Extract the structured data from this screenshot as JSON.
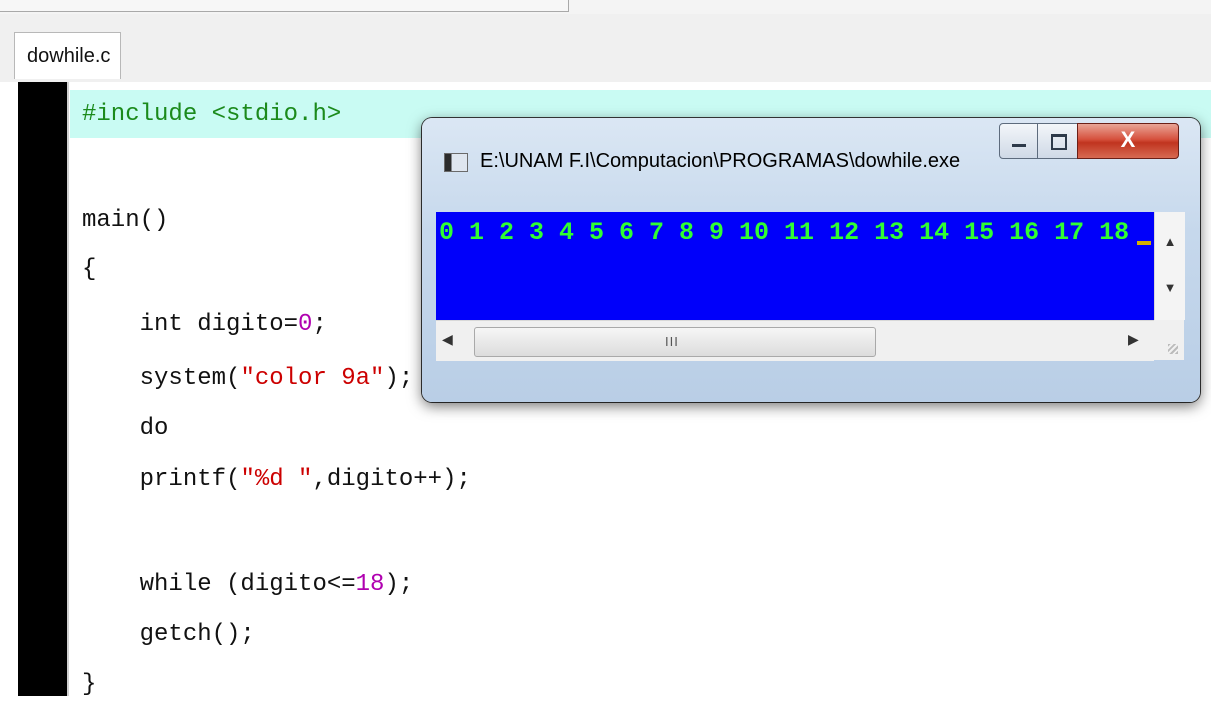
{
  "editor": {
    "tab_label": "dowhile.c",
    "lines": {
      "include": "#include <stdio.h>",
      "main_sig": "main()",
      "open_brace": "{",
      "decl_prefix": "    int digito=",
      "decl_num": "0",
      "decl_suffix": ";",
      "system_prefix": "    system(",
      "system_str": "\"color 9a\"",
      "system_suffix": ");",
      "do_kw": "    do",
      "printf_prefix": "    printf(",
      "printf_str": "\"%d \"",
      "printf_suffix": ",digito++);",
      "while_prefix": "    while (digito<=",
      "while_num": "18",
      "while_suffix": ");",
      "getch": "    getch();",
      "close_brace": "}"
    }
  },
  "console_window": {
    "title": "E:\\UNAM F.I\\Computacion\\PROGRAMAS\\dowhile.exe",
    "close_label": "X",
    "output": "0 1 2 3 4 5 6 7 8 9 10 11 12 13 14 15 16 17 18",
    "background_color": "#0000fa",
    "text_color": "#30ff30",
    "scroll_up": "▲",
    "scroll_down": "▼",
    "scroll_left": "◀",
    "scroll_right": "▶",
    "thumb_grip": "III"
  }
}
